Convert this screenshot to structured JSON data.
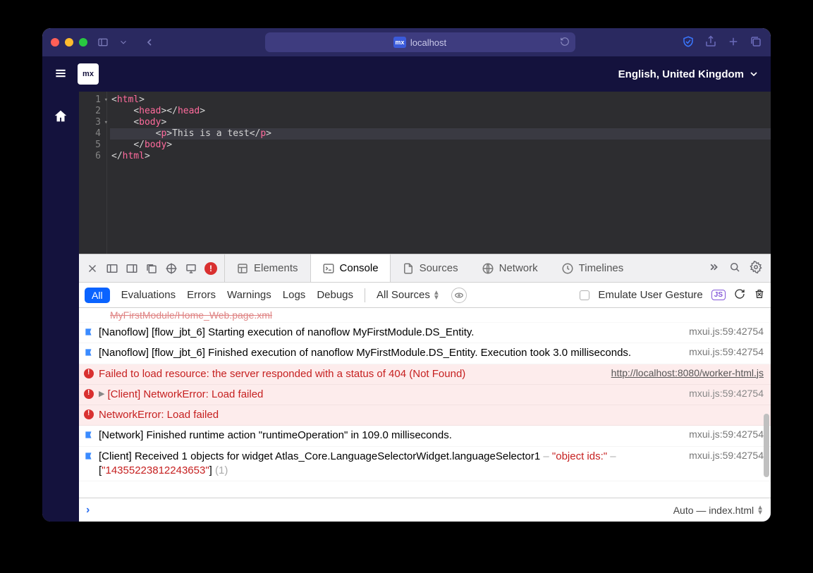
{
  "titlebar": {
    "address": "localhost",
    "mx_badge": "mx"
  },
  "header": {
    "mx_logo": "mx",
    "language": "English, United Kingdom"
  },
  "editor": {
    "lines": [
      {
        "n": "1",
        "indent": 0,
        "fold": true,
        "segments": [
          [
            "cp",
            "<"
          ],
          [
            "ct",
            "html"
          ],
          [
            "cp",
            ">"
          ]
        ]
      },
      {
        "n": "2",
        "indent": 1,
        "segments": [
          [
            "cp",
            "<"
          ],
          [
            "ct",
            "head"
          ],
          [
            "cp",
            "></"
          ],
          [
            "ct",
            "head"
          ],
          [
            "cp",
            ">"
          ]
        ]
      },
      {
        "n": "3",
        "indent": 1,
        "fold": true,
        "segments": [
          [
            "cp",
            "<"
          ],
          [
            "ct",
            "body"
          ],
          [
            "cp",
            ">"
          ]
        ]
      },
      {
        "n": "4",
        "indent": 2,
        "hl": true,
        "segments": [
          [
            "cp",
            "<"
          ],
          [
            "ct",
            "p"
          ],
          [
            "cp",
            ">"
          ],
          [
            "cx",
            "This is a test"
          ],
          [
            "cp",
            "</"
          ],
          [
            "ct",
            "p"
          ],
          [
            "cp",
            ">"
          ]
        ]
      },
      {
        "n": "5",
        "indent": 1,
        "segments": [
          [
            "cp",
            "</"
          ],
          [
            "ct",
            "body"
          ],
          [
            "cp",
            ">"
          ]
        ]
      },
      {
        "n": "6",
        "indent": 0,
        "segments": [
          [
            "cp",
            "</"
          ],
          [
            "ct",
            "html"
          ],
          [
            "cp",
            ">"
          ]
        ]
      }
    ]
  },
  "devtools": {
    "err_badge": "!",
    "tabs": {
      "elements": "Elements",
      "console": "Console",
      "sources": "Sources",
      "network": "Network",
      "timelines": "Timelines"
    },
    "filter": {
      "all": "All",
      "evaluations": "Evaluations",
      "errors": "Errors",
      "warnings": "Warnings",
      "logs": "Logs",
      "debugs": "Debugs",
      "all_sources": "All Sources",
      "emulate": "Emulate User Gesture",
      "js": "JS"
    },
    "partial_row": "MyFirstModule/Home_Web.page.xml",
    "rows": [
      {
        "type": "info",
        "msg": "[Nanoflow] [flow_jbt_6] Starting execution of nanoflow MyFirstModule.DS_Entity.",
        "src": "mxui.js:59:42754"
      },
      {
        "type": "info",
        "msg": "[Nanoflow] [flow_jbt_6] Finished execution of nanoflow MyFirstModule.DS_Entity. Execution took 3.0 milliseconds.",
        "src": "mxui.js:59:42754"
      },
      {
        "type": "err",
        "msg": "Failed to load resource: the server responded with a status of 404 (Not Found)",
        "link": "http://localhost:8080/worker-html.js"
      },
      {
        "type": "err",
        "disclosure": true,
        "msg": "[Client] NetworkError: Load failed",
        "src": "mxui.js:59:42754"
      },
      {
        "type": "err",
        "msg": "NetworkError: Load failed"
      },
      {
        "type": "info",
        "msg": "[Network] Finished runtime action \"runtimeOperation\" in 109.0 milliseconds.",
        "src": "mxui.js:59:42754"
      },
      {
        "type": "obj",
        "prefix": "[Client] Received 1 objects for widget Atlas_Core.LanguageSelectorWidget.languageSelector1",
        "key": "\"object ids:\"",
        "array": "[\"14355223812243653\"]",
        "count": "(1)",
        "src": "mxui.js:59:42754"
      }
    ],
    "footer_context": "Auto — index.html"
  }
}
